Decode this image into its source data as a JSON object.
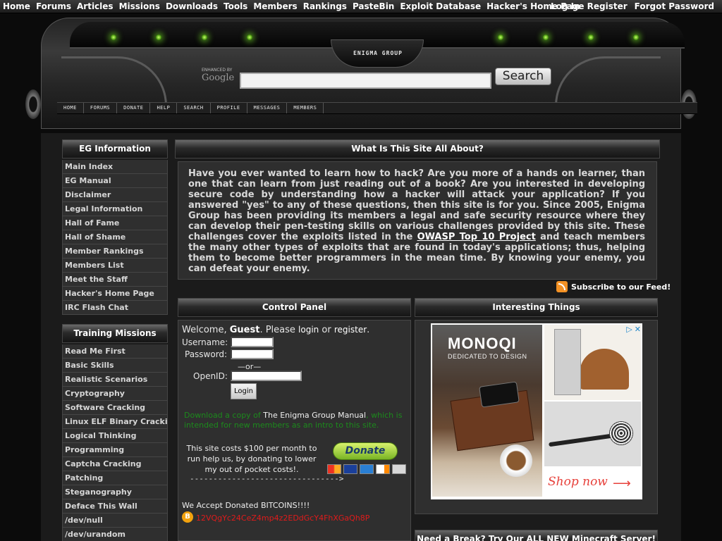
{
  "topnav": {
    "left": [
      "Home",
      "Forums",
      "Articles",
      "Missions",
      "Downloads",
      "Tools",
      "Members",
      "Rankings",
      "PasteBin",
      "Exploit Database",
      "Hacker's Home Page"
    ],
    "right": [
      "Log In",
      "Register",
      "Forgot Password"
    ]
  },
  "header": {
    "logo_text": "ENIGMA GROUP",
    "google_enhanced": "ENHANCED BY",
    "google_word": "Google",
    "search_value": "",
    "search_button": "Search",
    "subnav": [
      "HOME",
      "FORUMS",
      "DONATE",
      "HELP",
      "SEARCH",
      "PROFILE",
      "MESSAGES",
      "MEMBERS"
    ]
  },
  "sidebar": {
    "eg_info": {
      "title": "EG Information",
      "items": [
        "Main Index",
        "EG Manual",
        "Disclaimer",
        "Legal Information",
        "Hall of Fame",
        "Hall of Shame",
        "Member Rankings",
        "Members List",
        "Meet the Staff",
        "Hacker's Home Page",
        "IRC Flash Chat"
      ]
    },
    "training": {
      "title": "Training Missions",
      "items": [
        "Read Me First",
        "Basic Skills",
        "Realistic Scenarios",
        "Cryptography",
        "Software Cracking",
        "Linux ELF Binary Cracking",
        "Logical Thinking",
        "Programming",
        "Captcha Cracking",
        "Patching",
        "Steganography",
        "Deface This Wall",
        "/dev/null",
        "/dev/urandom"
      ]
    }
  },
  "main": {
    "title": "What Is This Site All About?",
    "about_before": "Have you ever wanted to learn how to hack? Are you more of a hands on learner, than one that can learn from just reading out of a book? Are you interested in developing secure code by understanding how a hacker will attack your application? If you answered \"yes\" to any of these questions, then this site is for you. Since 2005, Enigma Group has been providing its members a legal and safe security resource where they can develop their pen-testing skills on various challenges provided by this site. These challenges cover the exploits listed in the ",
    "about_link": "OWASP Top 10 Project",
    "about_after": " and teach members the many other types of exploits that are found in today's applications; thus, helping them to become better programmers in the mean time. By knowing your enemy, you can defeat your enemy.",
    "rss_label": "Subscribe to our Feed!"
  },
  "control_panel": {
    "title": "Control Panel",
    "welcome": "Welcome,",
    "guest": "Guest",
    "please": ". Please",
    "login_link": "login",
    "or": "or",
    "register_link": "register",
    "period": ".",
    "username_label": "Username:",
    "password_label": "Password:",
    "or_sep": "—or—",
    "openid_label": "OpenID:",
    "username_value": "",
    "password_value": "",
    "openid_value": "",
    "login_button": "Login",
    "manual_pre": "Download a copy of ",
    "manual_link": "The Enigma Group Manual",
    "manual_post": ", which is intended for new members as an intro to this site.",
    "costs_text": "This site costs $100 per month to run help us, by donating to lower my out of pocket costs!.",
    "dashes": "-------------------------------->",
    "donate_button": "Donate",
    "cards": [
      "MC",
      "VISA",
      "AMEX",
      "DISC",
      "BANK"
    ],
    "bitcoin_title": "We Accept Donated BITCOINS!!!!",
    "bitcoin_address": "12VQgYc24CeZ4mp4z2EDdGcY4FhXGaQh8P"
  },
  "interesting": {
    "title": "Interesting Things",
    "ad_brand": "MONOQI",
    "ad_tagline": "DEDICATED TO DESIGN",
    "ad_shop": "Shop now"
  },
  "minecraft": {
    "title": "Need a Break? Try Our ALL NEW Minecraft Server!"
  }
}
